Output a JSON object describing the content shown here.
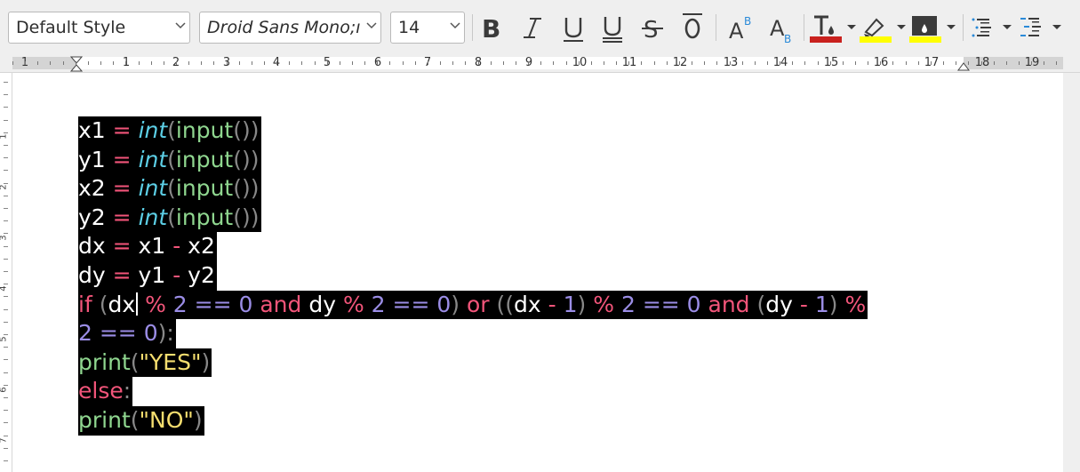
{
  "toolbar": {
    "paragraph_style": "Default Style",
    "font_name": "Droid Sans Mono;ı",
    "font_size": "14",
    "colors": {
      "font_color": "#c9211e",
      "highlight_color": "#ffff00",
      "char_background": "#ffff00"
    },
    "buttons": [
      {
        "name": "bold-button",
        "icon": "bold-icon"
      },
      {
        "name": "italic-button",
        "icon": "italic-icon"
      },
      {
        "name": "underline-button",
        "icon": "underline-icon"
      },
      {
        "name": "double-underline-button",
        "icon": "double-underline-icon"
      },
      {
        "name": "strikethrough-button",
        "icon": "strikethrough-icon"
      },
      {
        "name": "overline-button",
        "icon": "overline-icon"
      },
      {
        "name": "superscript-button",
        "icon": "superscript-icon"
      },
      {
        "name": "subscript-button",
        "icon": "subscript-icon"
      },
      {
        "name": "font-color-button",
        "icon": "font-color-icon"
      },
      {
        "name": "highlight-button",
        "icon": "highlighter-icon"
      },
      {
        "name": "char-background-button",
        "icon": "background-fill-icon"
      },
      {
        "name": "bullet-list-button",
        "icon": "bullet-list-icon"
      },
      {
        "name": "numbered-list-button",
        "icon": "numbered-list-icon"
      }
    ]
  },
  "ruler": {
    "numbers": [
      "1",
      "1",
      "2",
      "3",
      "4",
      "5",
      "6",
      "7",
      "8",
      "9",
      "10",
      "11",
      "12",
      "13",
      "14",
      "15",
      "16",
      "17",
      "18",
      "19"
    ]
  },
  "vruler": {
    "numbers": [
      "1",
      "2",
      "3",
      "4",
      "5",
      "6",
      "7"
    ]
  },
  "document": {
    "lines": [
      [
        {
          "t": "x1 ",
          "c": "var"
        },
        {
          "t": "=",
          "c": "op"
        },
        {
          "t": " ",
          "c": "var"
        },
        {
          "t": "int",
          "c": "type"
        },
        {
          "t": "(",
          "c": "paren"
        },
        {
          "t": "input",
          "c": "fn"
        },
        {
          "t": "())",
          "c": "paren"
        }
      ],
      [
        {
          "t": "y1 ",
          "c": "var"
        },
        {
          "t": "=",
          "c": "op"
        },
        {
          "t": " ",
          "c": "var"
        },
        {
          "t": "int",
          "c": "type"
        },
        {
          "t": "(",
          "c": "paren"
        },
        {
          "t": "input",
          "c": "fn"
        },
        {
          "t": "())",
          "c": "paren"
        }
      ],
      [
        {
          "t": "x2 ",
          "c": "var"
        },
        {
          "t": "=",
          "c": "op"
        },
        {
          "t": " ",
          "c": "var"
        },
        {
          "t": "int",
          "c": "type"
        },
        {
          "t": "(",
          "c": "paren"
        },
        {
          "t": "input",
          "c": "fn"
        },
        {
          "t": "())",
          "c": "paren"
        }
      ],
      [
        {
          "t": "y2 ",
          "c": "var"
        },
        {
          "t": "=",
          "c": "op"
        },
        {
          "t": " ",
          "c": "var"
        },
        {
          "t": "int",
          "c": "type"
        },
        {
          "t": "(",
          "c": "paren"
        },
        {
          "t": "input",
          "c": "fn"
        },
        {
          "t": "())",
          "c": "paren"
        }
      ],
      [
        {
          "t": "dx ",
          "c": "var"
        },
        {
          "t": "=",
          "c": "op"
        },
        {
          "t": " x1 ",
          "c": "var"
        },
        {
          "t": "-",
          "c": "op"
        },
        {
          "t": " x2",
          "c": "var"
        }
      ],
      [
        {
          "t": "dy ",
          "c": "var"
        },
        {
          "t": "=",
          "c": "op"
        },
        {
          "t": " y1 ",
          "c": "var"
        },
        {
          "t": "-",
          "c": "op"
        },
        {
          "t": " y2",
          "c": "var"
        }
      ],
      [
        {
          "t": "if",
          "c": "kw"
        },
        {
          "t": " (",
          "c": "paren"
        },
        {
          "t": "dx",
          "c": "var"
        },
        {
          "t": "CARET",
          "c": "caret"
        },
        {
          "t": " %",
          "c": "op"
        },
        {
          "t": " 2 ",
          "c": "num"
        },
        {
          "t": "==",
          "c": "num"
        },
        {
          "t": " 0 ",
          "c": "num"
        },
        {
          "t": "and",
          "c": "kw"
        },
        {
          "t": " dy ",
          "c": "var"
        },
        {
          "t": "%",
          "c": "op"
        },
        {
          "t": " 2 == 0",
          "c": "num"
        },
        {
          "t": ")",
          "c": "paren"
        },
        {
          "t": " or ",
          "c": "kw"
        },
        {
          "t": "((",
          "c": "paren"
        },
        {
          "t": "dx ",
          "c": "var"
        },
        {
          "t": "-",
          "c": "op"
        },
        {
          "t": " 1",
          "c": "num"
        },
        {
          "t": ") ",
          "c": "paren"
        },
        {
          "t": "%",
          "c": "op"
        },
        {
          "t": " 2 == 0 ",
          "c": "num"
        },
        {
          "t": "and",
          "c": "kw"
        },
        {
          "t": " (",
          "c": "paren"
        },
        {
          "t": "dy ",
          "c": "var"
        },
        {
          "t": "-",
          "c": "op"
        },
        {
          "t": " 1",
          "c": "num"
        },
        {
          "t": ") ",
          "c": "paren"
        },
        {
          "t": "%",
          "c": "op"
        }
      ],
      [
        {
          "t": "2 == 0",
          "c": "num"
        },
        {
          "t": "):",
          "c": "paren"
        }
      ],
      [
        {
          "t": "print",
          "c": "fn"
        },
        {
          "t": "(",
          "c": "paren"
        },
        {
          "t": "\"YES\"",
          "c": "str"
        },
        {
          "t": ")",
          "c": "paren"
        }
      ],
      [
        {
          "t": "else",
          "c": "kw"
        },
        {
          "t": ":",
          "c": "paren"
        }
      ],
      [
        {
          "t": "print",
          "c": "fn"
        },
        {
          "t": "(",
          "c": "paren"
        },
        {
          "t": "\"NO\"",
          "c": "str"
        },
        {
          "t": ")",
          "c": "paren"
        }
      ]
    ]
  }
}
